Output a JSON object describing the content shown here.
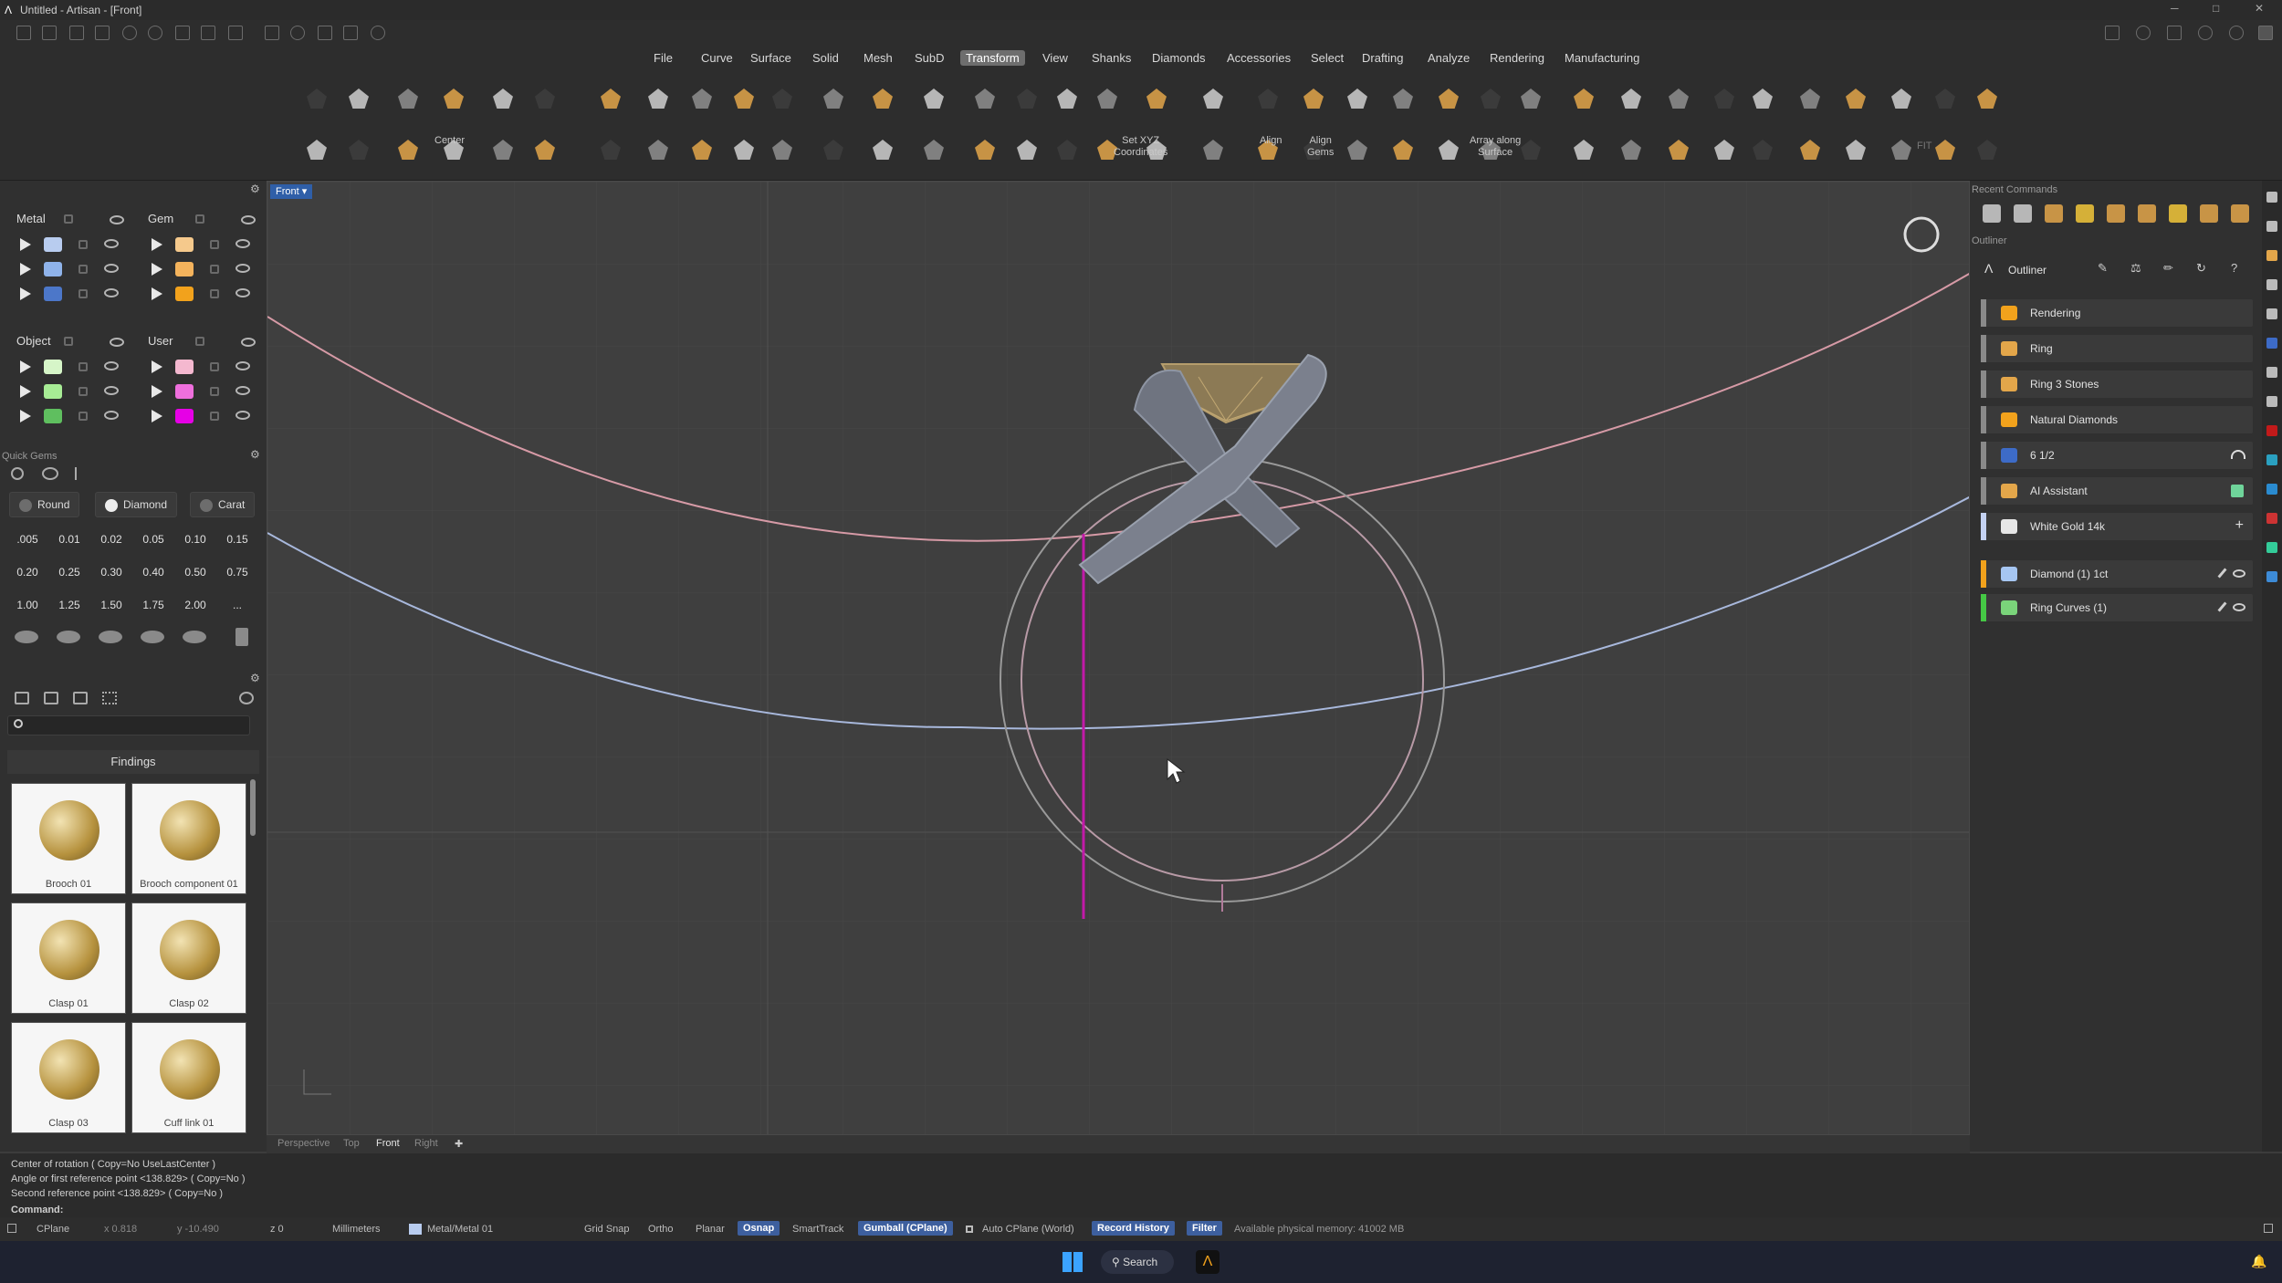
{
  "window": {
    "title": "Untitled - Artisan - [Front]"
  },
  "menu": [
    "File",
    "Curve",
    "Surface",
    "Solid",
    "Mesh",
    "SubD",
    "Transform",
    "View",
    "Shanks",
    "Diamonds",
    "Accessories",
    "Select",
    "Drafting",
    "Analyze",
    "Rendering",
    "Manufacturing"
  ],
  "menu_active": "Transform",
  "ribbon_labels": {
    "center": "Center",
    "set_xyz": "Set XYZ\nCoordinates",
    "align": "Align",
    "align_gems": "Align\nGems",
    "array_surface": "Array along\nSurface",
    "fit": "FIT"
  },
  "layers": {
    "metal": {
      "title": "Metal",
      "colors": [
        "#b8ccef",
        "#8fb3ea",
        "#4c77c9"
      ]
    },
    "gem": {
      "title": "Gem",
      "colors": [
        "#f5c98c",
        "#f4b35c",
        "#f2a21c"
      ]
    },
    "object": {
      "title": "Object",
      "colors": [
        "#d6f5c8",
        "#a7ec95",
        "#5fbf5f"
      ]
    },
    "user": {
      "title": "User",
      "colors": [
        "#f4b8cf",
        "#ef6fdd",
        "#e600e6"
      ]
    }
  },
  "quick_gems": {
    "title": "Quick Gems",
    "tabs": [
      {
        "label": "Round",
        "color": "#6d6d6d"
      },
      {
        "label": "Diamond",
        "color": "#ededed"
      },
      {
        "label": "Carat",
        "color": "#6d6d6d"
      }
    ],
    "values": [
      ".005",
      "0.01",
      "0.02",
      "0.05",
      "0.10",
      "0.15",
      "0.20",
      "0.25",
      "0.30",
      "0.40",
      "0.50",
      "0.75",
      "1.00",
      "1.25",
      "1.50",
      "1.75",
      "2.00",
      "..."
    ]
  },
  "findings": {
    "title": "Findings",
    "items": [
      "Brooch 01",
      "Brooch component 01",
      "Clasp 01",
      "Clasp 02",
      "Clasp 03",
      "Cuff link 01"
    ]
  },
  "viewport": {
    "name": "Front",
    "tabs": [
      "Perspective",
      "Top",
      "Front",
      "Right"
    ],
    "active_tab": "Front"
  },
  "panels": {
    "recent": "Recent Commands",
    "outliner": "Outliner"
  },
  "outliner": [
    {
      "label": "Rendering",
      "color": "#f2a21c",
      "bar": "#8a8a8a"
    },
    {
      "label": "Ring",
      "color": "#e3a64a",
      "bar": "#8a8a8a"
    },
    {
      "label": "Ring 3 Stones",
      "color": "#e3a64a",
      "bar": "#8a8a8a"
    },
    {
      "label": "Natural Diamonds",
      "color": "#f2a21c",
      "bar": "#8a8a8a"
    },
    {
      "label": "6 1/2",
      "color": "#3d6bc7",
      "bar": "#8a8a8a"
    },
    {
      "label": "AI Assistant",
      "color": "#e3a64a",
      "bar": "#8a8a8a"
    },
    {
      "label": "White Gold 14k",
      "color": "#e6e6e6",
      "bar": "#c4d2f2"
    },
    {
      "label": "Diamond (1) 1ct",
      "color": "#a6c6f2",
      "bar": "#f2a21c"
    },
    {
      "label": "Ring Curves (1)",
      "color": "#7ad47a",
      "bar": "#45c945"
    }
  ],
  "command_history": [
    "Center of rotation ( Copy=No  UseLastCenter )",
    "Angle or first reference point <138.829> ( Copy=No )",
    "Second reference point <138.829> ( Copy=No )"
  ],
  "command_label": "Command:",
  "status": {
    "cplane": "CPlane",
    "x": "x 0.818",
    "y": "y -10.490",
    "z": "z 0",
    "units": "Millimeters",
    "layer": "Metal/Metal 01",
    "grid_snap": "Grid Snap",
    "ortho": "Ortho",
    "planar": "Planar",
    "osnap": "Osnap",
    "smarttrack": "SmartTrack",
    "gumball": "Gumball (CPlane)",
    "auto_cplane": "Auto CPlane (World)",
    "record_history": "Record History",
    "filter": "Filter",
    "memory": "Available physical memory: 41002 MB"
  },
  "taskbar": {
    "search": "Search"
  }
}
